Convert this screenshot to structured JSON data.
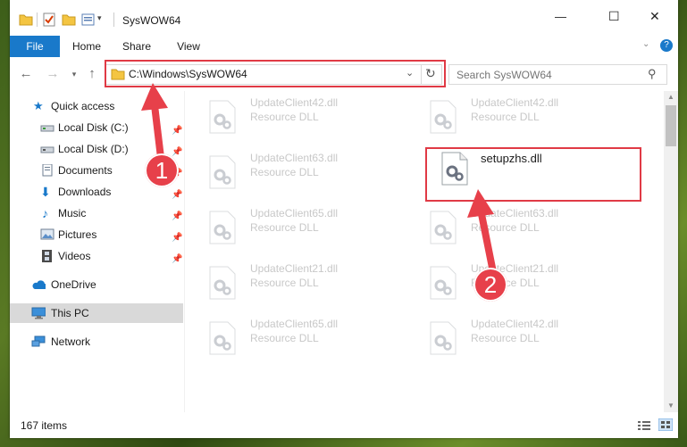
{
  "window": {
    "title": "SysWOW64"
  },
  "title_controls": {
    "minimize": "—",
    "maximize": "☐",
    "close": "✕"
  },
  "ribbon": {
    "tabs": [
      {
        "label": "File"
      },
      {
        "label": "Home"
      },
      {
        "label": "Share"
      },
      {
        "label": "View"
      }
    ]
  },
  "address": {
    "path": "C:\\Windows\\SysWOW64"
  },
  "search": {
    "placeholder": "Search SysWOW64"
  },
  "sidebar": {
    "items": [
      {
        "label": "Quick access"
      },
      {
        "label": "Local Disk (C:)"
      },
      {
        "label": "Local Disk (D:)"
      },
      {
        "label": "Documents"
      },
      {
        "label": "Downloads"
      },
      {
        "label": "Music"
      },
      {
        "label": "Pictures"
      },
      {
        "label": "Videos"
      },
      {
        "label": "OneDrive"
      },
      {
        "label": "This PC"
      },
      {
        "label": "Network"
      }
    ]
  },
  "files": [
    {
      "name": "UpdateClient42.dll",
      "type": "Resource DLL"
    },
    {
      "name": "UpdateClient42.dll",
      "type": "Resource DLL"
    },
    {
      "name": "UpdateClient63.dll",
      "type": "Resource DLL"
    },
    {
      "name": "setupzhs.dll",
      "type": ""
    },
    {
      "name": "UpdateClient65.dll",
      "type": "Resource DLL"
    },
    {
      "name": "UpdateClient63.dll",
      "type": "Resource DLL"
    },
    {
      "name": "UpdateClient21.dll",
      "type": "Resource DLL"
    },
    {
      "name": "UpdateClient21.dll",
      "type": "Resource DLL"
    },
    {
      "name": "UpdateClient65.dll",
      "type": "Resource DLL"
    },
    {
      "name": "UpdateClient42.dll",
      "type": "Resource DLL"
    }
  ],
  "status": {
    "count": "167 items"
  },
  "annotations": {
    "badge1": "1",
    "badge2": "2"
  },
  "colors": {
    "accent": "#1979ca",
    "highlight": "#e03a45",
    "selected": "#d9d9d9"
  }
}
